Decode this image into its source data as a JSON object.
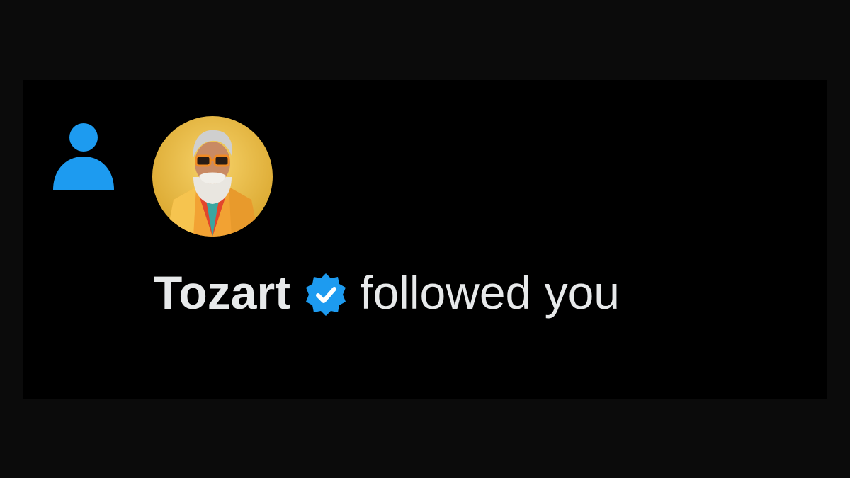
{
  "notification": {
    "type_icon": "person-icon",
    "avatar_icon": "user-avatar",
    "user_name": "Tozart",
    "badge_icon": "verified-badge-icon",
    "action_text": "followed you"
  },
  "colors": {
    "accent": "#1d9bf0",
    "text": "#e7e9ea",
    "background": "#000000",
    "divider": "#3d4149"
  }
}
